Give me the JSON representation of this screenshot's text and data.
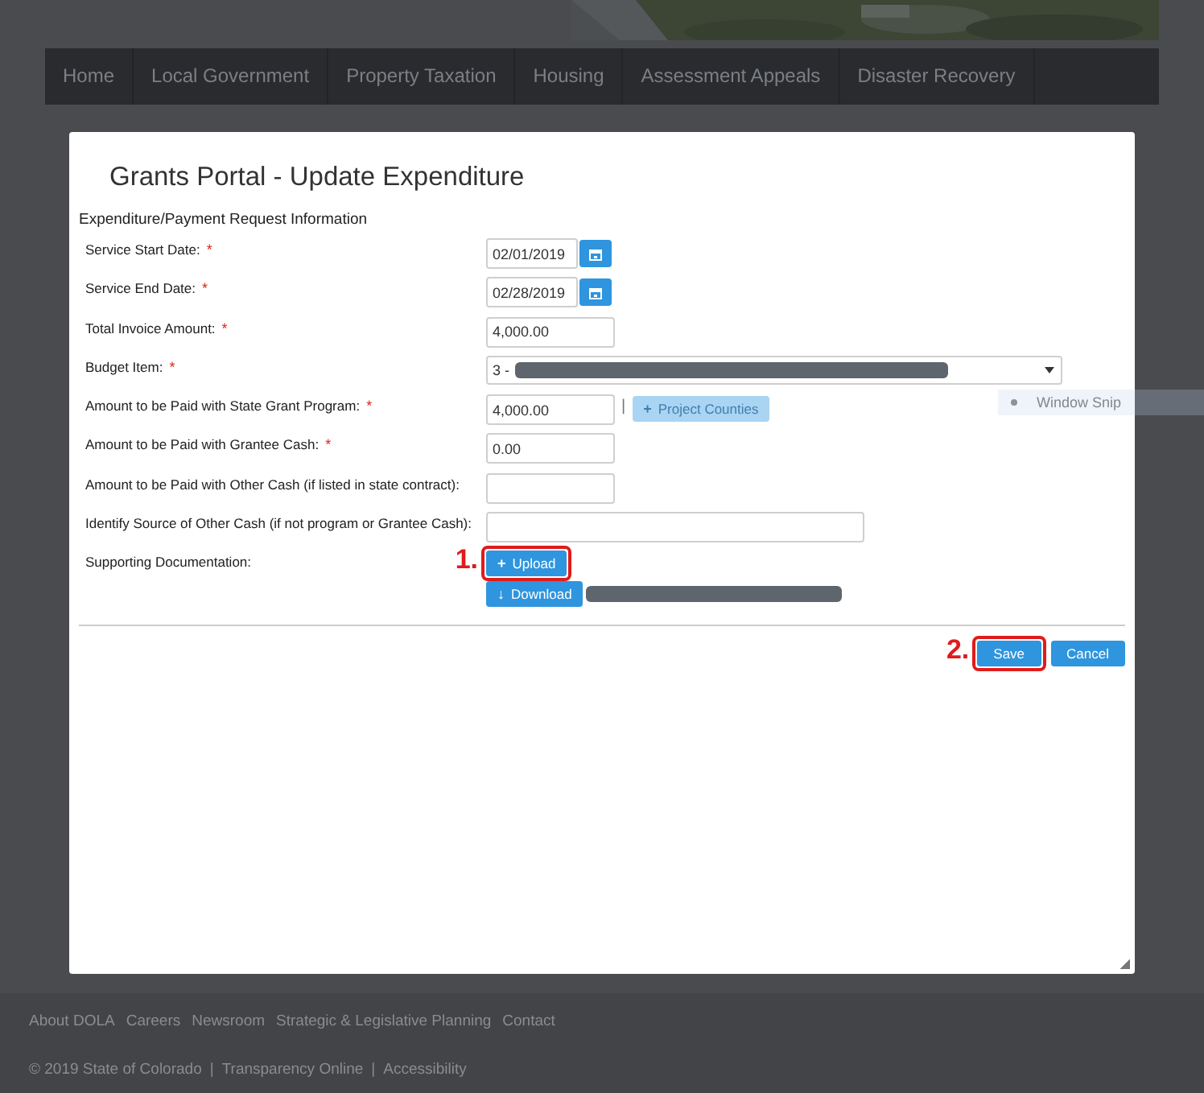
{
  "nav": [
    {
      "label": "Home"
    },
    {
      "label": "Local Government"
    },
    {
      "label": "Property Taxation"
    },
    {
      "label": "Housing"
    },
    {
      "label": "Assessment Appeals"
    },
    {
      "label": "Disaster Recovery"
    }
  ],
  "modal": {
    "title": "Grants Portal - Update Expenditure",
    "section": "Expenditure/Payment Request Information",
    "fields": [
      {
        "kind": "date",
        "label": "Service Start Date:",
        "required_mark": "*",
        "value": "02/01/2019"
      },
      {
        "kind": "date",
        "label": "Service End Date:",
        "required_mark": "*",
        "value": "02/28/2019"
      },
      {
        "kind": "text",
        "label": "Total Invoice Amount:",
        "required_mark": "*",
        "value": "4,000.00"
      },
      {
        "kind": "select",
        "label": "Budget Item:",
        "required_mark": "*",
        "value": "3 -",
        "redacted": true
      },
      {
        "kind": "amount_button",
        "label": "Amount to be Paid with State Grant Program:",
        "required_mark": "*",
        "value": "4,000.00",
        "separator": "|",
        "button": {
          "icon": "+",
          "label": "Project Counties",
          "disabled": true
        }
      },
      {
        "kind": "text",
        "label": "Amount to be Paid with Grantee Cash:",
        "required_mark": "*",
        "value": "0.00"
      },
      {
        "kind": "text",
        "label": "Amount to be Paid with Other Cash (if listed in state contract):"
      },
      {
        "kind": "wide",
        "label": "Identify Source of Other Cash (if not program or Grantee Cash):"
      },
      {
        "kind": "files",
        "label": "Supporting Documentation:",
        "upload": {
          "icon": "+",
          "label": "Upload",
          "callout": "1."
        },
        "download": {
          "icon": "↓",
          "label": "Download",
          "redacted": true
        }
      }
    ],
    "actions": [
      {
        "label": "Save",
        "callout": "2."
      },
      {
        "label": "Cancel"
      }
    ]
  },
  "snip_tooltip": {
    "label": "Window Snip"
  },
  "footer": {
    "links": [
      {
        "label": "About DOLA"
      },
      {
        "label": "Careers"
      },
      {
        "label": "Newsroom"
      },
      {
        "label": "Strategic & Legislative Planning"
      },
      {
        "label": "Contact"
      }
    ],
    "copyright": "© 2019 State of Colorado",
    "legal": [
      {
        "label": "Transparency Online"
      },
      {
        "label": "Accessibility"
      }
    ],
    "separator": "|"
  }
}
